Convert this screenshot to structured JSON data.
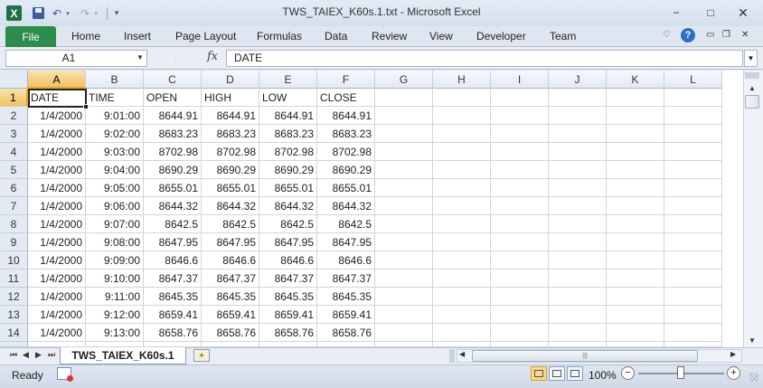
{
  "window": {
    "title": "TWS_TAIEX_K60s.1.txt  -  Microsoft Excel",
    "minimize": "−",
    "maximize": "□",
    "close": "✕"
  },
  "quick_access": {
    "app_icon": "X",
    "save_icon": "save-icon",
    "undo_icon": "↶",
    "redo_icon": "↷",
    "dropdown": "▾",
    "customize": "▾"
  },
  "ribbon": {
    "file": "File",
    "tabs": [
      "Home",
      "Insert",
      "Page Layout",
      "Formulas",
      "Data",
      "Review",
      "View",
      "Developer",
      "Team"
    ],
    "collapse": "♡",
    "help": "?",
    "wb_minimize": "▭",
    "wb_restore": "❐",
    "wb_close": "✕"
  },
  "formula_bar": {
    "name_box": "A1",
    "fx": "fx",
    "content": "DATE",
    "name_drop": "▼",
    "expand": "▼"
  },
  "grid": {
    "columns": [
      "A",
      "B",
      "C",
      "D",
      "E",
      "F",
      "G",
      "H",
      "I",
      "J",
      "K",
      "L"
    ],
    "row_numbers": [
      "1",
      "2",
      "3",
      "4",
      "5",
      "6",
      "7",
      "8",
      "9",
      "10",
      "11",
      "12",
      "13",
      "14"
    ],
    "rows": [
      [
        "DATE",
        "TIME",
        "OPEN",
        "HIGH",
        "LOW",
        "CLOSE"
      ],
      [
        "1/4/2000",
        "9:01:00",
        "8644.91",
        "8644.91",
        "8644.91",
        "8644.91"
      ],
      [
        "1/4/2000",
        "9:02:00",
        "8683.23",
        "8683.23",
        "8683.23",
        "8683.23"
      ],
      [
        "1/4/2000",
        "9:03:00",
        "8702.98",
        "8702.98",
        "8702.98",
        "8702.98"
      ],
      [
        "1/4/2000",
        "9:04:00",
        "8690.29",
        "8690.29",
        "8690.29",
        "8690.29"
      ],
      [
        "1/4/2000",
        "9:05:00",
        "8655.01",
        "8655.01",
        "8655.01",
        "8655.01"
      ],
      [
        "1/4/2000",
        "9:06:00",
        "8644.32",
        "8644.32",
        "8644.32",
        "8644.32"
      ],
      [
        "1/4/2000",
        "9:07:00",
        "8642.5",
        "8642.5",
        "8642.5",
        "8642.5"
      ],
      [
        "1/4/2000",
        "9:08:00",
        "8647.95",
        "8647.95",
        "8647.95",
        "8647.95"
      ],
      [
        "1/4/2000",
        "9:09:00",
        "8646.6",
        "8646.6",
        "8646.6",
        "8646.6"
      ],
      [
        "1/4/2000",
        "9:10:00",
        "8647.37",
        "8647.37",
        "8647.37",
        "8647.37"
      ],
      [
        "1/4/2000",
        "9:11:00",
        "8645.35",
        "8645.35",
        "8645.35",
        "8645.35"
      ],
      [
        "1/4/2000",
        "9:12:00",
        "8659.41",
        "8659.41",
        "8659.41",
        "8659.41"
      ],
      [
        "1/4/2000",
        "9:13:00",
        "8658.76",
        "8658.76",
        "8658.76",
        "8658.76"
      ]
    ]
  },
  "sheet_tabs": {
    "active": "TWS_TAIEX_K60s.1",
    "nav": [
      "⏮",
      "◀",
      "▶",
      "⏭"
    ]
  },
  "status": {
    "text": "Ready",
    "zoom": "100%",
    "zoom_out": "−",
    "zoom_in": "+"
  },
  "colors": {
    "file_tab": "#2c8c4b",
    "selection_header": "#f1c15f",
    "grid_line": "#d4d4d4"
  }
}
